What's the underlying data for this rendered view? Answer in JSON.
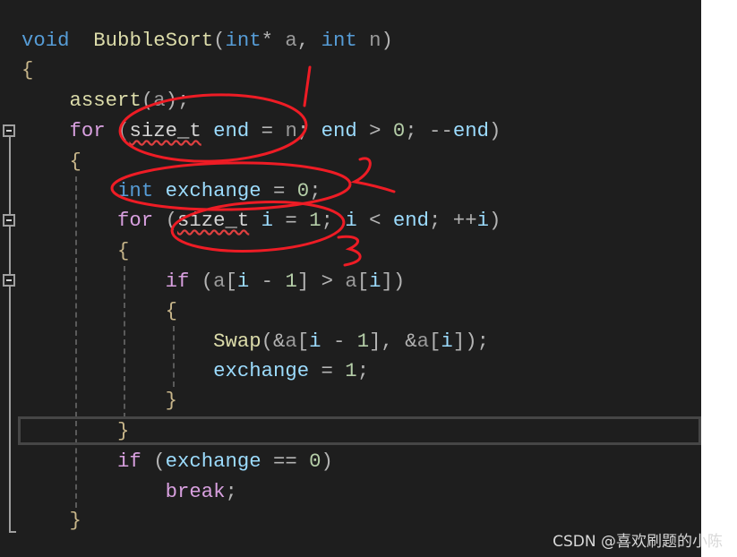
{
  "code_lines": [
    [
      [
        "kw",
        "void"
      ],
      [
        "",
        "  "
      ],
      [
        "fn",
        "BubbleSort"
      ],
      [
        "pun",
        "("
      ],
      [
        "kw",
        "int"
      ],
      [
        "pun",
        "*"
      ],
      [
        "param",
        " a"
      ],
      [
        "pun",
        ", "
      ],
      [
        "kw",
        "int"
      ],
      [
        "param",
        " n"
      ],
      [
        "pun",
        ")"
      ]
    ],
    [
      [
        "brace",
        "{"
      ]
    ],
    [
      [
        "",
        "    "
      ],
      [
        "fn",
        "assert"
      ],
      [
        "pun",
        "("
      ],
      [
        "param",
        "a"
      ],
      [
        "pun",
        ");"
      ]
    ],
    [
      [
        "",
        "    "
      ],
      [
        "ctl",
        "for"
      ],
      [
        "pun",
        " ("
      ],
      [
        "type",
        "size_t"
      ],
      [
        "var",
        " end"
      ],
      [
        "pun",
        " = "
      ],
      [
        "param",
        "n"
      ],
      [
        "pun",
        "; "
      ],
      [
        "var",
        "end"
      ],
      [
        "pun",
        " > "
      ],
      [
        "num",
        "0"
      ],
      [
        "pun",
        "; --"
      ],
      [
        "var",
        "end"
      ],
      [
        "pun",
        ")"
      ]
    ],
    [
      [
        "",
        "    "
      ],
      [
        "brace",
        "{"
      ]
    ],
    [
      [
        "",
        "        "
      ],
      [
        "kw",
        "int"
      ],
      [
        "var",
        " exchange"
      ],
      [
        "pun",
        " = "
      ],
      [
        "num",
        "0"
      ],
      [
        "pun",
        ";"
      ]
    ],
    [
      [
        "",
        "        "
      ],
      [
        "ctl",
        "for"
      ],
      [
        "pun",
        " ("
      ],
      [
        "type",
        "size_t"
      ],
      [
        "var",
        " i"
      ],
      [
        "pun",
        " = "
      ],
      [
        "num",
        "1"
      ],
      [
        "pun",
        "; "
      ],
      [
        "var",
        "i"
      ],
      [
        "pun",
        " < "
      ],
      [
        "var",
        "end"
      ],
      [
        "pun",
        "; ++"
      ],
      [
        "var",
        "i"
      ],
      [
        "pun",
        ")"
      ]
    ],
    [
      [
        "",
        "        "
      ],
      [
        "brace",
        "{"
      ]
    ],
    [
      [
        "",
        "            "
      ],
      [
        "ctl",
        "if"
      ],
      [
        "pun",
        " ("
      ],
      [
        "param",
        "a"
      ],
      [
        "pun",
        "["
      ],
      [
        "var",
        "i"
      ],
      [
        "pun",
        " - "
      ],
      [
        "num",
        "1"
      ],
      [
        "pun",
        "] > "
      ],
      [
        "param",
        "a"
      ],
      [
        "pun",
        "["
      ],
      [
        "var",
        "i"
      ],
      [
        "pun",
        "])"
      ]
    ],
    [
      [
        "",
        "            "
      ],
      [
        "brace",
        "{"
      ]
    ],
    [
      [
        "",
        "                "
      ],
      [
        "fn",
        "Swap"
      ],
      [
        "pun",
        "(&"
      ],
      [
        "param",
        "a"
      ],
      [
        "pun",
        "["
      ],
      [
        "var",
        "i"
      ],
      [
        "pun",
        " - "
      ],
      [
        "num",
        "1"
      ],
      [
        "pun",
        "], &"
      ],
      [
        "param",
        "a"
      ],
      [
        "pun",
        "["
      ],
      [
        "var",
        "i"
      ],
      [
        "pun",
        "]);"
      ]
    ],
    [
      [
        "",
        "                "
      ],
      [
        "var",
        "exchange"
      ],
      [
        "pun",
        " = "
      ],
      [
        "num",
        "1"
      ],
      [
        "pun",
        ";"
      ]
    ],
    [
      [
        "",
        "            "
      ],
      [
        "brace",
        "}"
      ]
    ],
    [
      [
        "",
        "        "
      ],
      [
        "brace",
        "}"
      ]
    ],
    [
      [
        "",
        "        "
      ],
      [
        "ctl",
        "if"
      ],
      [
        "pun",
        " ("
      ],
      [
        "var",
        "exchange"
      ],
      [
        "pun",
        " == "
      ],
      [
        "num",
        "0"
      ],
      [
        "pun",
        ")"
      ]
    ],
    [
      [
        "",
        "            "
      ],
      [
        "ctl",
        "break"
      ],
      [
        "pun",
        ";"
      ]
    ],
    [
      [
        "",
        "    "
      ],
      [
        "brace",
        "}"
      ]
    ]
  ],
  "annotations": [
    "1",
    "2",
    "3"
  ],
  "annotation_color": "#ee1c25",
  "watermark": "CSDN @喜欢刷题的小陈"
}
